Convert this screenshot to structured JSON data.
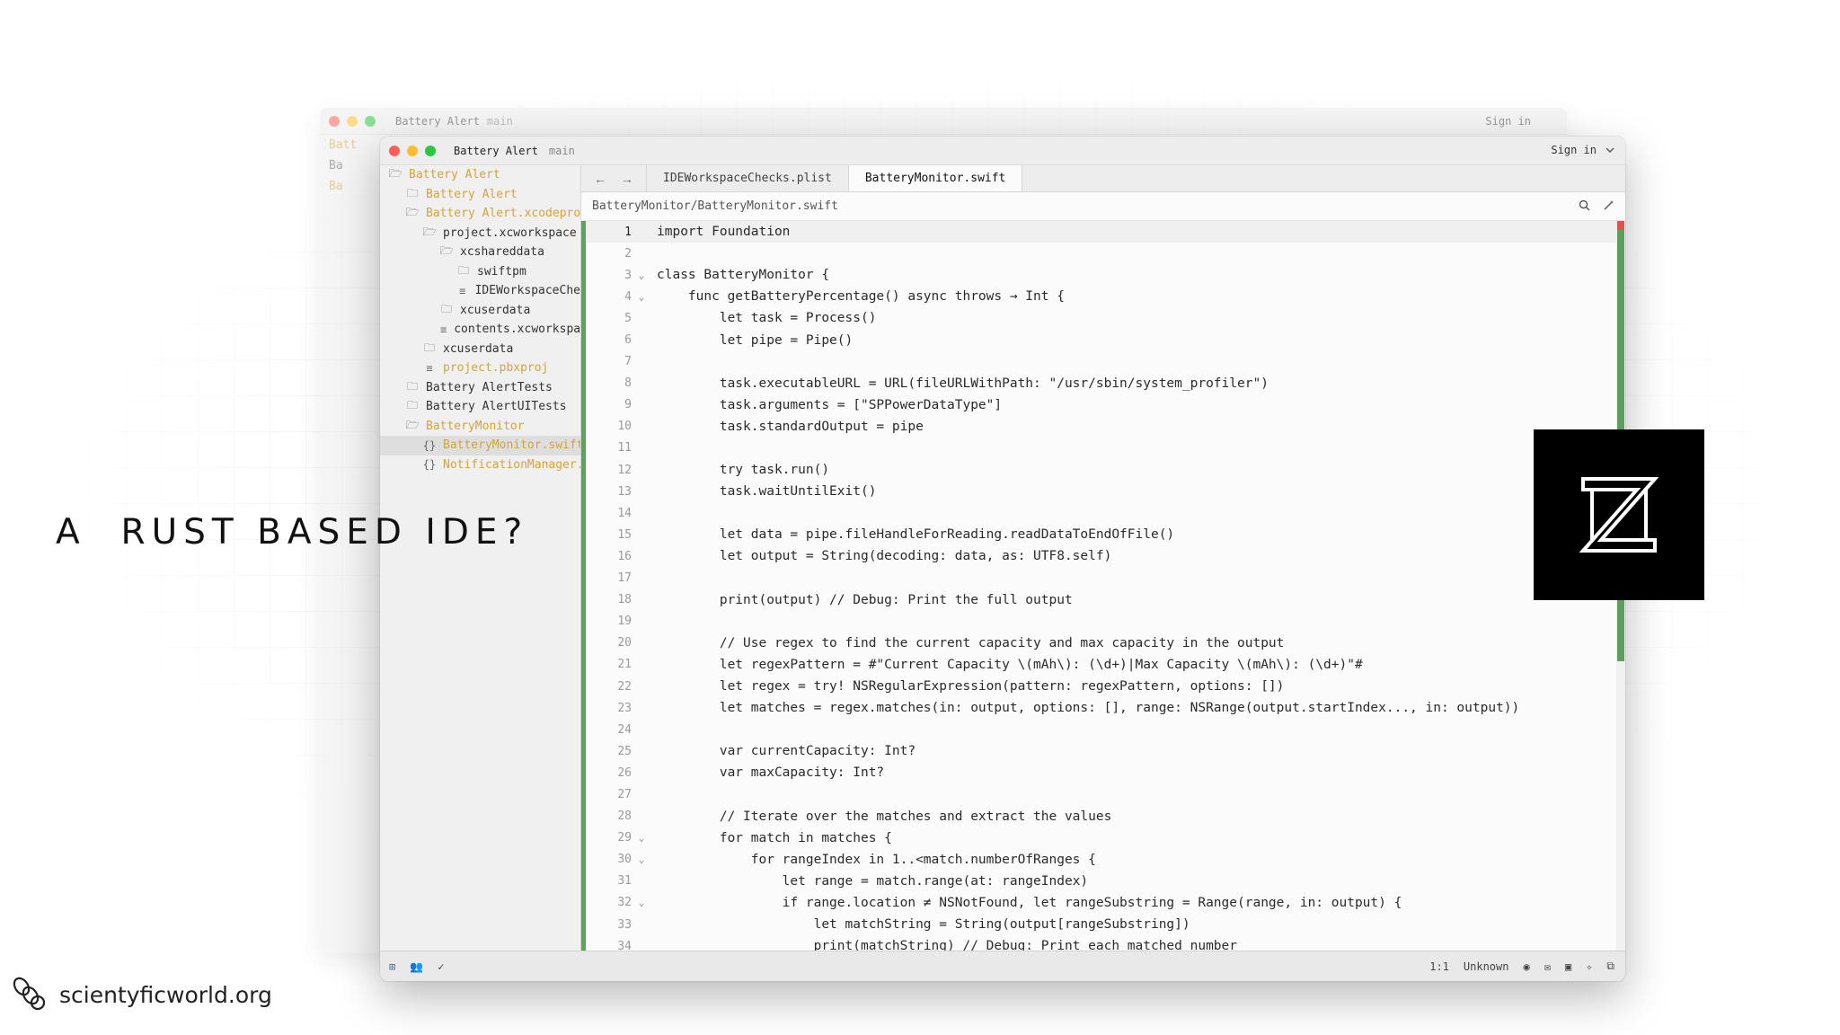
{
  "headline": "A  RUST BASED IDE?",
  "brand": {
    "site": "scientyficworld.org",
    "icon": "scientyficworld-logo"
  },
  "window": {
    "project": "Battery Alert",
    "branch": "main",
    "sign_in": "Sign in"
  },
  "back_window": {
    "project": "Battery Alert",
    "branch": "main",
    "sign_in": "Sign in",
    "rows": [
      "Batt",
      "Ba",
      "Ba"
    ]
  },
  "sidebar": {
    "items": [
      {
        "label": "Battery Alert",
        "depth": 0,
        "icon": "folder-open-icon",
        "color": "yellow"
      },
      {
        "label": "Battery Alert",
        "depth": 1,
        "icon": "folder-icon",
        "color": "yellow"
      },
      {
        "label": "Battery Alert.xcodeproj",
        "depth": 1,
        "icon": "folder-open-icon",
        "color": "yellow"
      },
      {
        "label": "project.xcworkspace",
        "depth": 2,
        "icon": "folder-open-icon",
        "color": "normal"
      },
      {
        "label": "xcshareddata",
        "depth": 3,
        "icon": "folder-open-icon",
        "color": "normal"
      },
      {
        "label": "swiftpm",
        "depth": 4,
        "icon": "folder-icon",
        "color": "normal"
      },
      {
        "label": "IDEWorkspaceChe",
        "depth": 4,
        "icon": "file-lines-icon",
        "color": "normal"
      },
      {
        "label": "xcuserdata",
        "depth": 3,
        "icon": "folder-icon",
        "color": "normal"
      },
      {
        "label": "contents.xcworkspa",
        "depth": 3,
        "icon": "file-lines-icon",
        "color": "normal"
      },
      {
        "label": "xcuserdata",
        "depth": 2,
        "icon": "folder-icon",
        "color": "normal"
      },
      {
        "label": "project.pbxproj",
        "depth": 2,
        "icon": "file-lines-icon",
        "color": "yellow"
      },
      {
        "label": "Battery AlertTests",
        "depth": 1,
        "icon": "folder-icon",
        "color": "normal"
      },
      {
        "label": "Battery AlertUITests",
        "depth": 1,
        "icon": "folder-icon",
        "color": "normal"
      },
      {
        "label": "BatteryMonitor",
        "depth": 1,
        "icon": "folder-open-icon",
        "color": "yellow"
      },
      {
        "label": "BatteryMonitor.swift",
        "depth": 2,
        "icon": "braces-icon",
        "color": "yellow",
        "selected": true
      },
      {
        "label": "NotificationManager.s",
        "depth": 2,
        "icon": "braces-icon",
        "color": "yellow"
      }
    ]
  },
  "tabs": [
    {
      "label": "IDEWorkspaceChecks.plist",
      "active": false
    },
    {
      "label": "BatteryMonitor.swift",
      "active": true
    }
  ],
  "breadcrumb": "BatteryMonitor/BatteryMonitor.swift",
  "code": {
    "current_line": 1,
    "lines": [
      {
        "n": "1",
        "fold": "",
        "t": "import Foundation"
      },
      {
        "n": "2",
        "fold": "",
        "t": ""
      },
      {
        "n": "3",
        "fold": "⌄",
        "t": "class BatteryMonitor {"
      },
      {
        "n": "4",
        "fold": "⌄",
        "t": "    func getBatteryPercentage() async throws → Int {"
      },
      {
        "n": "5",
        "fold": "",
        "t": "        let task = Process()"
      },
      {
        "n": "6",
        "fold": "",
        "t": "        let pipe = Pipe()"
      },
      {
        "n": "7",
        "fold": "",
        "t": ""
      },
      {
        "n": "8",
        "fold": "",
        "t": "        task.executableURL = URL(fileURLWithPath: \"/usr/sbin/system_profiler\")"
      },
      {
        "n": "9",
        "fold": "",
        "t": "        task.arguments = [\"SPPowerDataType\"]"
      },
      {
        "n": "10",
        "fold": "",
        "t": "        task.standardOutput = pipe"
      },
      {
        "n": "11",
        "fold": "",
        "t": ""
      },
      {
        "n": "12",
        "fold": "",
        "t": "        try task.run()"
      },
      {
        "n": "13",
        "fold": "",
        "t": "        task.waitUntilExit()"
      },
      {
        "n": "14",
        "fold": "",
        "t": ""
      },
      {
        "n": "15",
        "fold": "",
        "t": "        let data = pipe.fileHandleForReading.readDataToEndOfFile()"
      },
      {
        "n": "16",
        "fold": "",
        "t": "        let output = String(decoding: data, as: UTF8.self)"
      },
      {
        "n": "17",
        "fold": "",
        "t": ""
      },
      {
        "n": "18",
        "fold": "",
        "t": "        print(output) // Debug: Print the full output"
      },
      {
        "n": "19",
        "fold": "",
        "t": ""
      },
      {
        "n": "20",
        "fold": "",
        "t": "        // Use regex to find the current capacity and max capacity in the output"
      },
      {
        "n": "21",
        "fold": "",
        "t": "        let regexPattern = #\"Current Capacity \\(mAh\\): (\\d+)|Max Capacity \\(mAh\\): (\\d+)\"#"
      },
      {
        "n": "22",
        "fold": "",
        "t": "        let regex = try! NSRegularExpression(pattern: regexPattern, options: [])"
      },
      {
        "n": "23",
        "fold": "",
        "t": "        let matches = regex.matches(in: output, options: [], range: NSRange(output.startIndex..., in: output))"
      },
      {
        "n": "24",
        "fold": "",
        "t": ""
      },
      {
        "n": "25",
        "fold": "",
        "t": "        var currentCapacity: Int?"
      },
      {
        "n": "26",
        "fold": "",
        "t": "        var maxCapacity: Int?"
      },
      {
        "n": "27",
        "fold": "",
        "t": ""
      },
      {
        "n": "28",
        "fold": "",
        "t": "        // Iterate over the matches and extract the values"
      },
      {
        "n": "29",
        "fold": "⌄",
        "t": "        for match in matches {"
      },
      {
        "n": "30",
        "fold": "⌄",
        "t": "            for rangeIndex in 1..<match.numberOfRanges {"
      },
      {
        "n": "31",
        "fold": "",
        "t": "                let range = match.range(at: rangeIndex)"
      },
      {
        "n": "32",
        "fold": "⌄",
        "t": "                if range.location ≠ NSNotFound, let rangeSubstring = Range(range, in: output) {"
      },
      {
        "n": "33",
        "fold": "",
        "t": "                    let matchString = String(output[rangeSubstring])"
      },
      {
        "n": "34",
        "fold": "",
        "t": "                    print(matchString) // Debug: Print each matched number"
      }
    ]
  },
  "status": {
    "cursor": "1:1",
    "language": "Unknown"
  },
  "colors": {
    "accent_yellow": "#d4a33b",
    "git_green": "#58a55c",
    "logo_bg": "#000000"
  }
}
